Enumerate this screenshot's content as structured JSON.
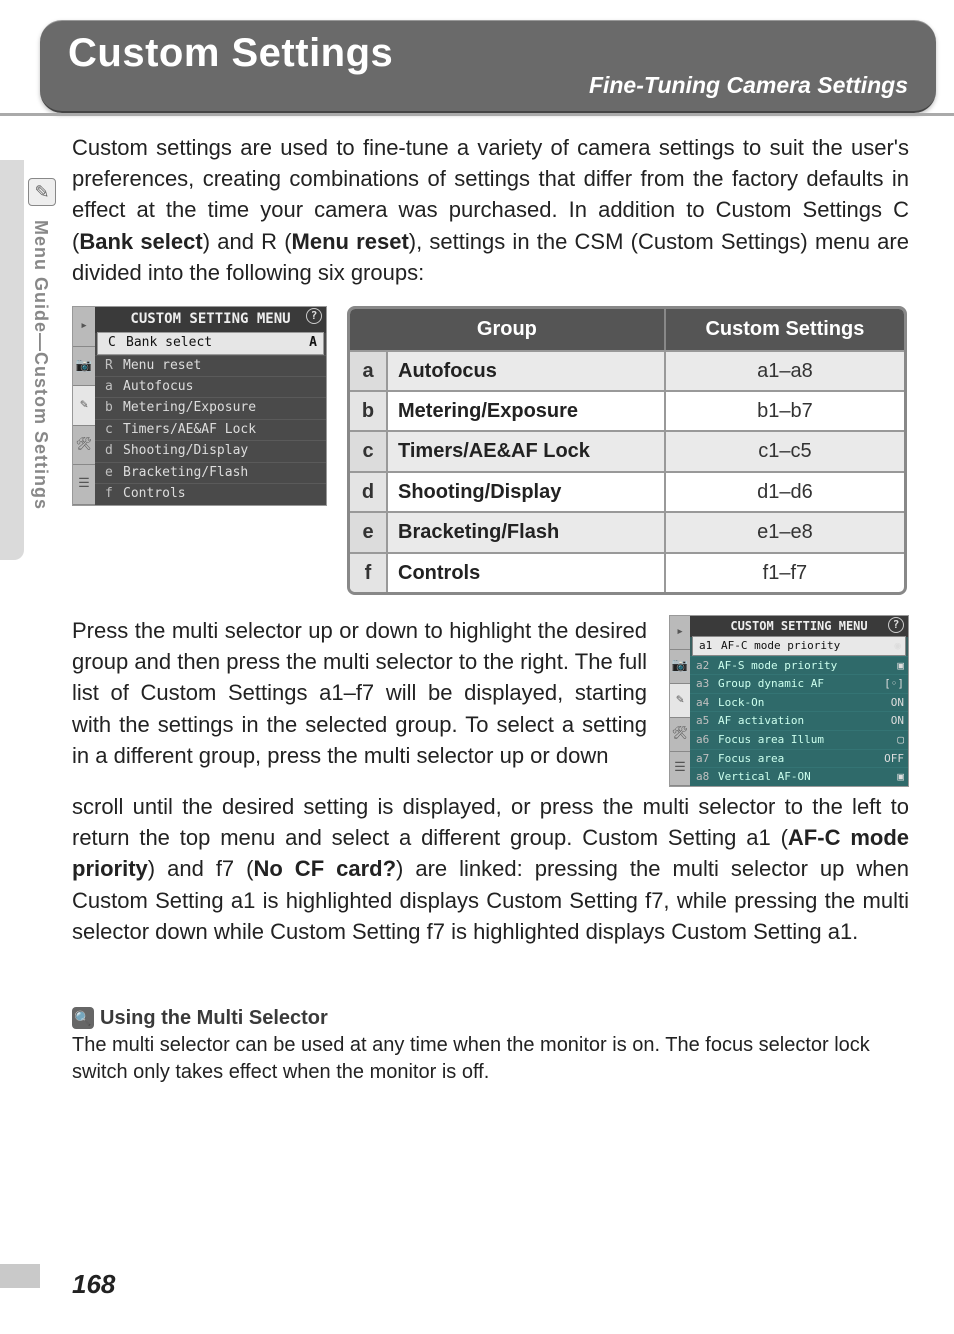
{
  "header": {
    "title": "Custom Settings",
    "subtitle": "Fine-Tuning Camera Settings"
  },
  "side_tab": {
    "icon": "✎",
    "label": "Menu Guide—Custom Settings"
  },
  "intro": {
    "part1": "Custom settings are used to fine-tune a variety of camera settings to suit the user's preferences, creating combinations of settings that differ from the factory defaults in effect at the time your camera was purchased.  In addition to Custom Settings C (",
    "bank_select": "Bank select",
    "part2": ") and R (",
    "menu_reset": "Menu reset",
    "part3": "), settings in the CSM (Custom Settings) menu are divided into the following six groups:"
  },
  "lcd1": {
    "title": "CUSTOM SETTING MENU",
    "tabs": [
      "▸",
      "📷",
      "✎",
      "🛠",
      "☰"
    ],
    "items": [
      {
        "code": "C",
        "label": "Bank select",
        "highlight": true
      },
      {
        "code": "R",
        "label": "Menu reset"
      },
      {
        "code": "a",
        "label": "Autofocus"
      },
      {
        "code": "b",
        "label": "Metering/Exposure"
      },
      {
        "code": "c",
        "label": "Timers/AE&AF Lock"
      },
      {
        "code": "d",
        "label": "Shooting/Display"
      },
      {
        "code": "e",
        "label": "Bracketing/Flash"
      },
      {
        "code": "f",
        "label": "Controls"
      }
    ]
  },
  "groups_table": {
    "headers": {
      "group": "Group",
      "settings": "Custom Settings"
    },
    "rows": [
      {
        "code": "a",
        "name": "Autofocus",
        "range": "a1–a8",
        "shade": true
      },
      {
        "code": "b",
        "name": "Metering/Exposure",
        "range": "b1–b7",
        "shade": false
      },
      {
        "code": "c",
        "name": "Timers/AE&AF Lock",
        "range": "c1–c5",
        "shade": true
      },
      {
        "code": "d",
        "name": "Shooting/Display",
        "range": "d1–d6",
        "shade": false
      },
      {
        "code": "e",
        "name": "Bracketing/Flash",
        "range": "e1–e8",
        "shade": true
      },
      {
        "code": "f",
        "name": "Controls",
        "range": "f1–f7",
        "shade": false
      }
    ]
  },
  "para2": {
    "lead": "Press the multi selector up or down to highlight the desired group and then press the multi selector to the right.  The full list of Custom Settings a1–f7 will be displayed, starting with the settings in the selected group.  To select a setting in a different group, press the multi selector up or down",
    "full_pre": "scroll until the desired setting is displayed, or press the multi selector to the left to return the top menu and select a different group.  Custom Setting a1 (",
    "afc": "AF-C mode priority",
    "mid1": ") and f7 (",
    "nocf": "No CF card?",
    "mid2": ") are linked: pressing the multi selector up when Custom Setting a1 is highlighted displays Custom Setting f7, while pressing the multi selector down while Custom Setting f7 is highlighted displays Custom Setting a1."
  },
  "lcd2": {
    "title": "CUSTOM SETTING MENU",
    "items": [
      {
        "code": "a1",
        "label": "AF-C mode priority",
        "val": "◉",
        "highlight": true
      },
      {
        "code": "a2",
        "label": "AF-S mode priority",
        "val": "▣"
      },
      {
        "code": "a3",
        "label": "Group dynamic AF",
        "val": "[◦]"
      },
      {
        "code": "a4",
        "label": "Lock-On",
        "val": "ON"
      },
      {
        "code": "a5",
        "label": "AF activation",
        "val": "ON"
      },
      {
        "code": "a6",
        "label": "Focus area Illum",
        "val": "▢"
      },
      {
        "code": "a7",
        "label": "Focus area",
        "val": "OFF"
      },
      {
        "code": "a8",
        "label": "Vertical AF-ON",
        "val": "▣"
      }
    ]
  },
  "tip": {
    "title": "Using the Multi Selector",
    "body": "The multi selector can be used at any time when the monitor is on.  The focus selector lock switch only takes effect when the monitor is off."
  },
  "page_number": "168"
}
